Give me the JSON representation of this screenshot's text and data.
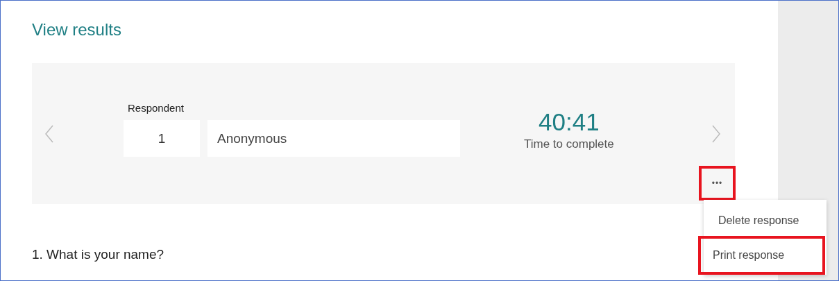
{
  "title": "View results",
  "respondent": {
    "label": "Respondent",
    "number": "1",
    "name": "Anonymous"
  },
  "timer": {
    "value": "40:41",
    "caption": "Time to complete"
  },
  "more_button": {
    "label": "•••",
    "highlighted": true
  },
  "menu": {
    "items": [
      {
        "label": "Delete response",
        "highlighted": false
      },
      {
        "label": "Print response",
        "highlighted": true
      }
    ]
  },
  "questions": [
    "1. What is your name?"
  ]
}
